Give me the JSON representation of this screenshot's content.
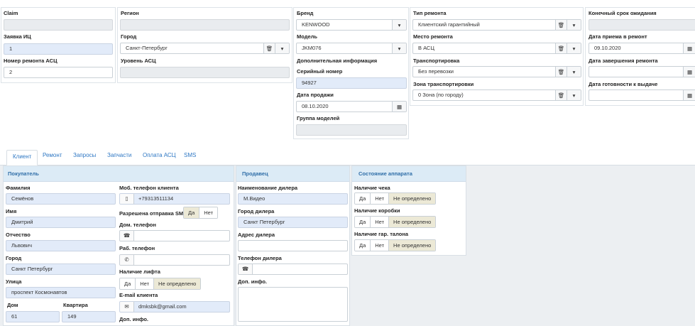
{
  "top": {
    "claim": {
      "label": "Claim",
      "value": ""
    },
    "zayavka": {
      "label": "Заявка ИЦ",
      "value": "1"
    },
    "nomer_asc": {
      "label": "Номер ремонта АСЦ",
      "value": "2"
    },
    "region": {
      "label": "Регион",
      "value": ""
    },
    "city": {
      "label": "Город",
      "value": "Санкт-Петербург"
    },
    "uroven": {
      "label": "Уровень АСЦ",
      "value": ""
    },
    "brand": {
      "label": "Бренд",
      "value": "KENWOOD"
    },
    "model": {
      "label": "Модель",
      "value": "JKM076"
    },
    "dop_info": {
      "label": "Дополнительная информация"
    },
    "serial": {
      "label": "Серийный номер",
      "value": "94927"
    },
    "sale_date": {
      "label": "Дата продажи",
      "value": "08.10.2020"
    },
    "group": {
      "label": "Группа моделей",
      "value": ""
    },
    "repair_type": {
      "label": "Тип ремонта",
      "value": "Клиентский гарантийный"
    },
    "repair_place": {
      "label": "Место ремонта",
      "value": "В АСЦ"
    },
    "transport": {
      "label": "Транспортировка",
      "value": "Без перевозки"
    },
    "zone": {
      "label": "Зона транспортировки",
      "value": "0 Зона (по городу)"
    },
    "deadline": {
      "label": "Конечный срок ожидания",
      "value": ""
    },
    "accept_date": {
      "label": "Дата приема в ремонт",
      "value": "09.10.2020"
    },
    "finish_date": {
      "label": "Дата завершения ремонта",
      "value": ""
    },
    "ready_date": {
      "label": "Дата готовности к выдаче",
      "value": ""
    }
  },
  "tabs": [
    "Клиент",
    "Ремонт",
    "Запросы",
    "Запчасти",
    "Оплата АСЦ",
    "SMS"
  ],
  "buyer": {
    "title": "Покупатель",
    "surname": {
      "label": "Фамилия",
      "value": "Семёнов"
    },
    "name": {
      "label": "Имя",
      "value": "Дмитрий"
    },
    "patronymic": {
      "label": "Отчество",
      "value": "Львович"
    },
    "city": {
      "label": "Город",
      "value": "Санкт Петербург"
    },
    "street": {
      "label": "Улица",
      "value": "проспект Космонавтов"
    },
    "house": {
      "label": "Дом",
      "value": "61"
    },
    "flat": {
      "label": "Квартира",
      "value": "149"
    },
    "mobile": {
      "label": "Моб. телефон клиента",
      "value": "+79313511134"
    },
    "sms": {
      "label": "Разрешена отправка SMS",
      "yes": "Да",
      "no": "Нет"
    },
    "home_phone": {
      "label": "Дом. телефон",
      "value": ""
    },
    "work_phone": {
      "label": "Раб. телефон",
      "value": ""
    },
    "lift": {
      "label": "Наличие лифта",
      "yes": "Да",
      "no": "Нет",
      "undef": "Не определено"
    },
    "email": {
      "label": "E-mail клиента",
      "value": "dmksbk@gmail.com"
    },
    "dop": {
      "label": "Доп. инфо."
    }
  },
  "seller": {
    "title": "Продавец",
    "dealer_name": {
      "label": "Наименование дилера",
      "value": "М.Видео"
    },
    "dealer_city": {
      "label": "Город дилера",
      "value": "Санкт Петербург"
    },
    "dealer_address": {
      "label": "Адрес дилера",
      "value": ""
    },
    "dealer_phone": {
      "label": "Телефон дилера",
      "value": ""
    },
    "dop": {
      "label": "Доп. инфо.",
      "value": ""
    }
  },
  "device": {
    "title": "Состояние аппарата",
    "check": {
      "label": "Наличие чека"
    },
    "box": {
      "label": "Наличие коробки"
    },
    "talon": {
      "label": "Наличие гар. талона"
    },
    "yes": "Да",
    "no": "Нет",
    "undef": "Не определено"
  }
}
